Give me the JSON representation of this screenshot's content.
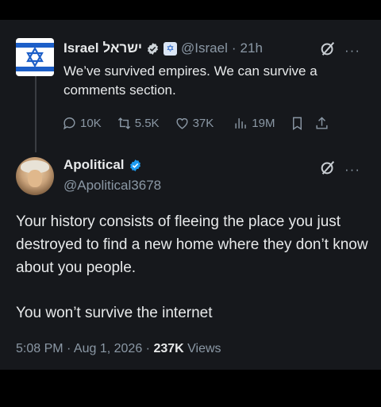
{
  "parent_tweet": {
    "display_name": "Israel",
    "hebrew_name": "ישראל",
    "handle": "@Israel",
    "separator": "·",
    "time": "21h",
    "text": "We’ve survived empires. We can survive a comments section.",
    "replies": "10K",
    "retweets": "5.5K",
    "likes": "37K",
    "views": "19M"
  },
  "reply": {
    "display_name": "Apolitical",
    "handle": "@Apolitical3678",
    "paragraph1": "Your history consists of fleeing the place you just destroyed to find a new home where they don’t know about you people.",
    "paragraph2": "You won’t survive the internet",
    "timestamp": "5:08 PM · Aug 1, 2026 · ",
    "views_count": "237K",
    "views_label": "Views"
  },
  "colors": {
    "background": "#000000",
    "panel": "#16181c",
    "text": "#e7e9ea",
    "muted": "#8b98a5",
    "verified_blue": "#1d9bf0"
  },
  "icons": [
    "star-of-david-icon",
    "verified-icon",
    "flag-badge-icon",
    "grok-icon",
    "more-icon",
    "reply-icon",
    "retweet-icon",
    "like-icon",
    "views-icon",
    "bookmark-icon",
    "share-icon"
  ]
}
